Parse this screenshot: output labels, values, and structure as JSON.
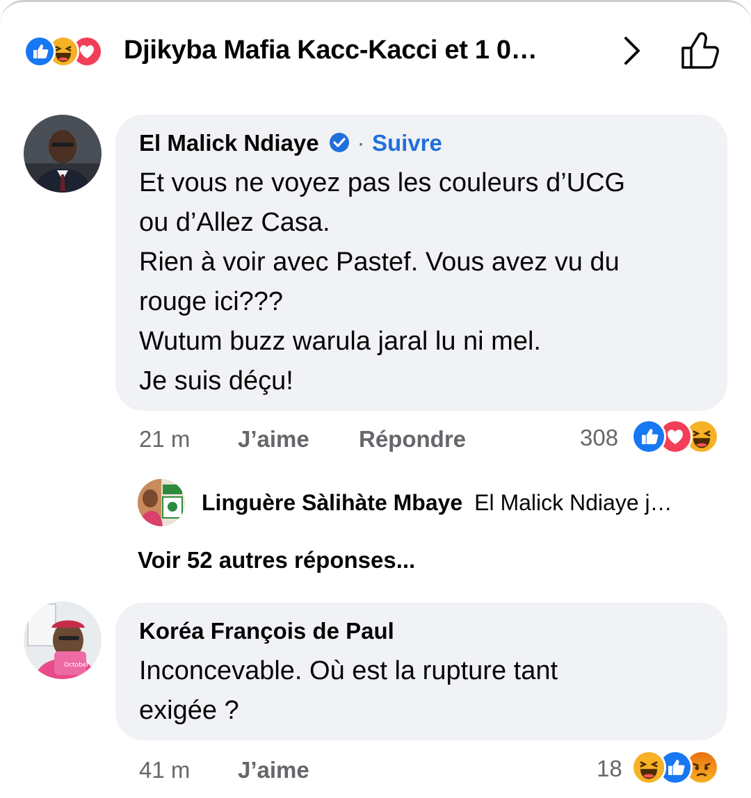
{
  "header": {
    "title": "Djikyba Mafia Kacc-Kacci et 1 0…",
    "reaction_icons": [
      "like-icon",
      "haha-icon",
      "love-icon"
    ]
  },
  "comments": [
    {
      "author": "El Malick Ndiaye",
      "verified": true,
      "follow_separator": "·",
      "follow_label": "Suivre",
      "text": "Et vous ne voyez pas les couleurs d’UCG\nou d’Allez Casa.\nRien à voir avec Pastef. Vous avez vu du\nrouge ici???\nWutum buzz warula jaral lu ni mel.\nJe suis déçu!",
      "time": "21 m",
      "like_label": "J’aime",
      "reply_label": "Répondre",
      "reaction_count": "308",
      "reaction_icons": [
        "like-icon",
        "love-icon",
        "haha-icon"
      ],
      "reply_preview": {
        "author": "Linguère Sàlihàte Mbaye",
        "text": "El Malick Ndiaye j…"
      },
      "more_replies": "Voir 52 autres réponses..."
    },
    {
      "author": "Koréa François de Paul",
      "text": "Inconcevable. Où est la rupture tant\nexigée ?",
      "time": "41 m",
      "like_label": "J’aime",
      "reaction_count": "18",
      "reaction_icons": [
        "haha-icon",
        "like-icon",
        "angry-icon"
      ],
      "avatar_badge": "October"
    }
  ],
  "colors": {
    "bubble": "#f0f2f5",
    "link_blue": "#216fdb",
    "meta_gray": "#65676b",
    "like_blue": "#1877f2",
    "love_red": "#f33e58",
    "haha_yellow": "#f7b125",
    "angry_orange": "#e9710f"
  }
}
